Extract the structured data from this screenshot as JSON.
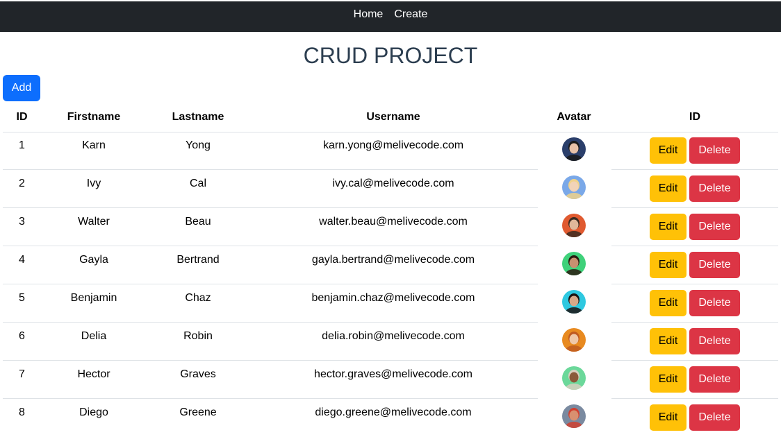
{
  "nav": {
    "home_label": "Home",
    "create_label": "Create"
  },
  "page": {
    "title": "CRUD PROJECT",
    "add_label": "Add"
  },
  "table": {
    "headers": [
      "ID",
      "Firstname",
      "Lastname",
      "Username",
      "Avatar",
      "ID"
    ],
    "rows": [
      {
        "id": "1",
        "firstname": "Karn",
        "lastname": "Yong",
        "username": "karn.yong@melivecode.com",
        "avatar": "person-photo",
        "edit": "Edit",
        "delete": "Delete"
      },
      {
        "id": "2",
        "firstname": "Ivy",
        "lastname": "Cal",
        "username": "ivy.cal@melivecode.com",
        "avatar": "person-photo",
        "edit": "Edit",
        "delete": "Delete"
      },
      {
        "id": "3",
        "firstname": "Walter",
        "lastname": "Beau",
        "username": "walter.beau@melivecode.com",
        "avatar": "person-photo",
        "edit": "Edit",
        "delete": "Delete"
      },
      {
        "id": "4",
        "firstname": "Gayla",
        "lastname": "Bertrand",
        "username": "gayla.bertrand@melivecode.com",
        "avatar": "person-photo",
        "edit": "Edit",
        "delete": "Delete"
      },
      {
        "id": "5",
        "firstname": "Benjamin",
        "lastname": "Chaz",
        "username": "benjamin.chaz@melivecode.com",
        "avatar": "person-photo",
        "edit": "Edit",
        "delete": "Delete"
      },
      {
        "id": "6",
        "firstname": "Delia",
        "lastname": "Robin",
        "username": "delia.robin@melivecode.com",
        "avatar": "person-photo",
        "edit": "Edit",
        "delete": "Delete"
      },
      {
        "id": "7",
        "firstname": "Hector",
        "lastname": "Graves",
        "username": "hector.graves@melivecode.com",
        "avatar": "person-photo",
        "edit": "Edit",
        "delete": "Delete"
      },
      {
        "id": "8",
        "firstname": "Diego",
        "lastname": "Greene",
        "username": "diego.greene@melivecode.com",
        "avatar": "person-photo",
        "edit": "Edit",
        "delete": "Delete"
      }
    ]
  },
  "colors": {
    "navbar": "#212529",
    "add_button": "#0d6efd",
    "edit_button": "#ffc107",
    "delete_button": "#dc3545",
    "title": "#2c3e50",
    "avatars": [
      {
        "bg": "#2b3f6b",
        "skin": "#e8c2a8",
        "hair": "#1a1a1a"
      },
      {
        "bg": "#7aa8e8",
        "skin": "#f2d3b8",
        "hair": "#f0d28a"
      },
      {
        "bg": "#e05a30",
        "skin": "#e0b89a",
        "hair": "#3a2a20"
      },
      {
        "bg": "#3fd17a",
        "skin": "#c89070",
        "hair": "#2a1a10"
      },
      {
        "bg": "#2ec8e0",
        "skin": "#d8a888",
        "hair": "#1a1210"
      },
      {
        "bg": "#e88a20",
        "skin": "#f0c8a8",
        "hair": "#c05a20"
      },
      {
        "bg": "#6bd89a",
        "skin": "#8a5a3a",
        "hair": "#d8d0c0"
      },
      {
        "bg": "#7a8aa0",
        "skin": "#d89070",
        "hair": "#d04030"
      }
    ]
  }
}
